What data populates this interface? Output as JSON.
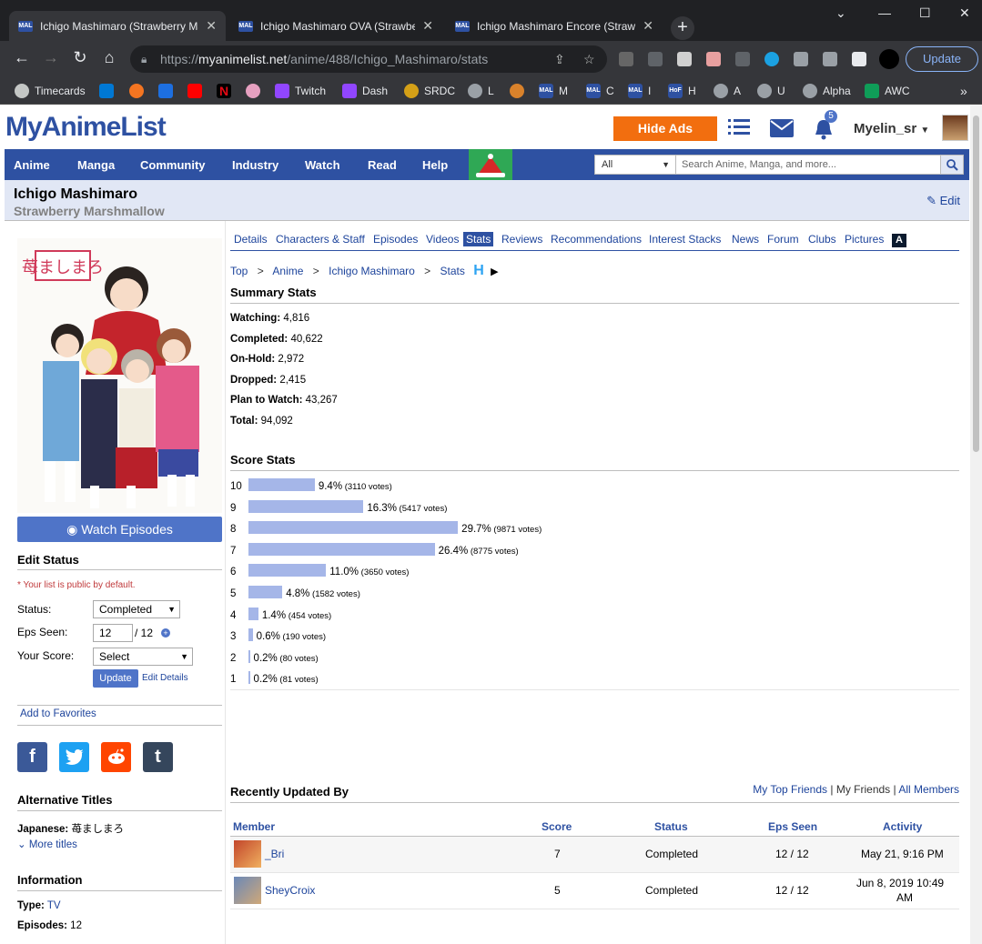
{
  "browser": {
    "tabs": [
      {
        "title": "Ichigo Mashimaro (Strawberry Ma",
        "active": true
      },
      {
        "title": "Ichigo Mashimaro OVA (Strawberr",
        "active": false
      },
      {
        "title": "Ichigo Mashimaro Encore (Strawb",
        "active": false
      }
    ],
    "url_prefix": "https://",
    "url_host": "myanimelist.net",
    "url_path": "/anime/488/Ichigo_Mashimaro/stats",
    "update_label": "Update",
    "bookmarks": [
      "Timecards",
      "Twitch",
      "Dash",
      "SRDC",
      "L",
      "M",
      "C",
      "I",
      "H",
      "A",
      "U",
      "Alpha",
      "AWC"
    ]
  },
  "header": {
    "logo": "MyAnimeList",
    "hide_ads": "Hide Ads",
    "notification_count": "5",
    "username": "Myelin_sr"
  },
  "menu": {
    "items": [
      "Anime",
      "Manga",
      "Community",
      "Industry",
      "Watch",
      "Read",
      "Help"
    ],
    "search_scope": "All",
    "search_placeholder": "Search Anime, Manga, and more..."
  },
  "title": {
    "main": "Ichigo Mashimaro",
    "english": "Strawberry Marshmallow",
    "edit": "Edit"
  },
  "sidebar": {
    "watch_episodes": "Watch Episodes",
    "edit_status_heading": "Edit Status",
    "public_note": "* Your list is public by default.",
    "status_label": "Status:",
    "status_value": "Completed",
    "eps_label": "Eps Seen:",
    "eps_value": "12",
    "eps_total": "/ 12",
    "score_label": "Your Score:",
    "score_value": "Select",
    "update": "Update",
    "edit_details": "Edit Details",
    "add_favorites": "Add to Favorites",
    "alt_titles_heading": "Alternative Titles",
    "japanese_label": "Japanese:",
    "japanese_value": "苺ましまろ",
    "more_titles": "More titles",
    "information_heading": "Information",
    "type_label": "Type:",
    "type_value": "TV",
    "episodes_label": "Episodes:",
    "episodes_value": "12"
  },
  "nav_tabs": [
    "Details",
    "Characters & Staff",
    "Episodes",
    "Videos",
    "Stats",
    "Reviews",
    "Recommendations",
    "Interest Stacks",
    "News",
    "Forum",
    "Clubs",
    "Pictures"
  ],
  "breadcrumb": [
    "Top",
    "Anime",
    "Ichigo Mashimaro",
    "Stats"
  ],
  "summary": {
    "heading": "Summary Stats",
    "rows": [
      {
        "label": "Watching:",
        "value": "4,816"
      },
      {
        "label": "Completed:",
        "value": "40,622"
      },
      {
        "label": "On-Hold:",
        "value": "2,972"
      },
      {
        "label": "Dropped:",
        "value": "2,415"
      },
      {
        "label": "Plan to Watch:",
        "value": "43,267"
      },
      {
        "label": "Total:",
        "value": "94,092"
      }
    ]
  },
  "score_stats": {
    "heading": "Score Stats"
  },
  "chart_data": {
    "type": "bar",
    "orientation": "horizontal",
    "categories": [
      "10",
      "9",
      "8",
      "7",
      "6",
      "5",
      "4",
      "3",
      "2",
      "1"
    ],
    "values": [
      9.4,
      16.3,
      29.7,
      26.4,
      11.0,
      4.8,
      1.4,
      0.6,
      0.2,
      0.2
    ],
    "votes": [
      3110,
      5417,
      9871,
      8775,
      3650,
      1582,
      454,
      190,
      80,
      81
    ],
    "percent_labels": [
      "9.4%",
      "16.3%",
      "29.7%",
      "26.4%",
      "11.0%",
      "4.8%",
      "1.4%",
      "0.6%",
      "0.2%",
      "0.2%"
    ],
    "vote_labels": [
      "(3110 votes)",
      "(5417 votes)",
      "(9871 votes)",
      "(8775 votes)",
      "(3650 votes)",
      "(1582 votes)",
      "(454 votes)",
      "(190 votes)",
      "(80 votes)",
      "(81 votes)"
    ],
    "bar_color": "#a5b6e8"
  },
  "recent": {
    "heading": "Recently Updated By",
    "links": [
      "My Top Friends",
      "My Friends",
      "All Members"
    ],
    "columns": [
      "Member",
      "Score",
      "Status",
      "Eps Seen",
      "Activity"
    ],
    "rows": [
      {
        "member": "_Bri",
        "score": "7",
        "status": "Completed",
        "eps": "12 / 12",
        "activity": "May 21, 9:16 PM",
        "activity2": ""
      },
      {
        "member": "SheyCroix",
        "score": "5",
        "status": "Completed",
        "eps": "12 / 12",
        "activity": "Jun 8, 2019 10:49",
        "activity2": "AM"
      }
    ]
  },
  "colors": {
    "brand": "#2e51a2",
    "hide_ads": "#f26e0f",
    "tab_bg": "#e1e7f5"
  }
}
